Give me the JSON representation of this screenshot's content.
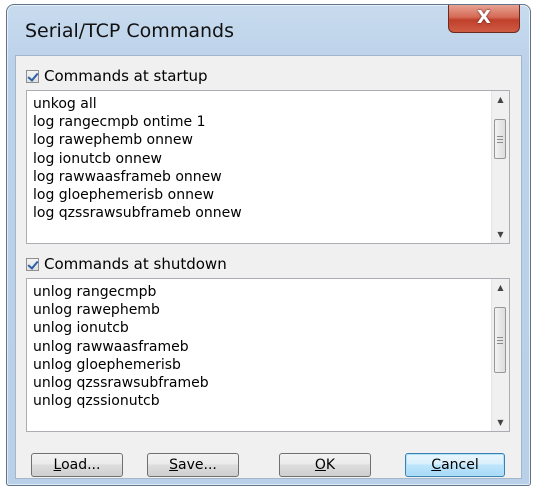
{
  "window": {
    "title": "Serial/TCP Commands",
    "close_glyph": "X"
  },
  "startup": {
    "checkbox_label": "Commands at startup",
    "checked": true,
    "lines": [
      "unkog all",
      "log rangecmpb ontime 1",
      "log rawephemb onnew",
      "log ionutcb onnew",
      "log rawwaasframeb onnew",
      "log gloephemerisb onnew",
      "log qzssrawsubframeb onnew"
    ]
  },
  "shutdown": {
    "checkbox_label": "Commands at shutdown",
    "checked": true,
    "lines": [
      "unlog rangecmpb",
      "unlog rawephemb",
      "unlog ionutcb",
      "unlog rawwaasframeb",
      "unlog gloephemerisb",
      "unlog qzssrawsubframeb",
      "unlog qzssionutcb"
    ]
  },
  "buttons": {
    "load": {
      "accel": "L",
      "rest": "oad..."
    },
    "save": {
      "accel": "S",
      "rest": "ave..."
    },
    "ok": {
      "accel": "O",
      "rest": "K"
    },
    "cancel": {
      "accel": "C",
      "rest": "ancel"
    }
  },
  "icons": {
    "close": "close-icon",
    "checkbox": "checkmark-icon",
    "scroll_up": "arrow-up-icon",
    "scroll_down": "arrow-down-icon"
  }
}
